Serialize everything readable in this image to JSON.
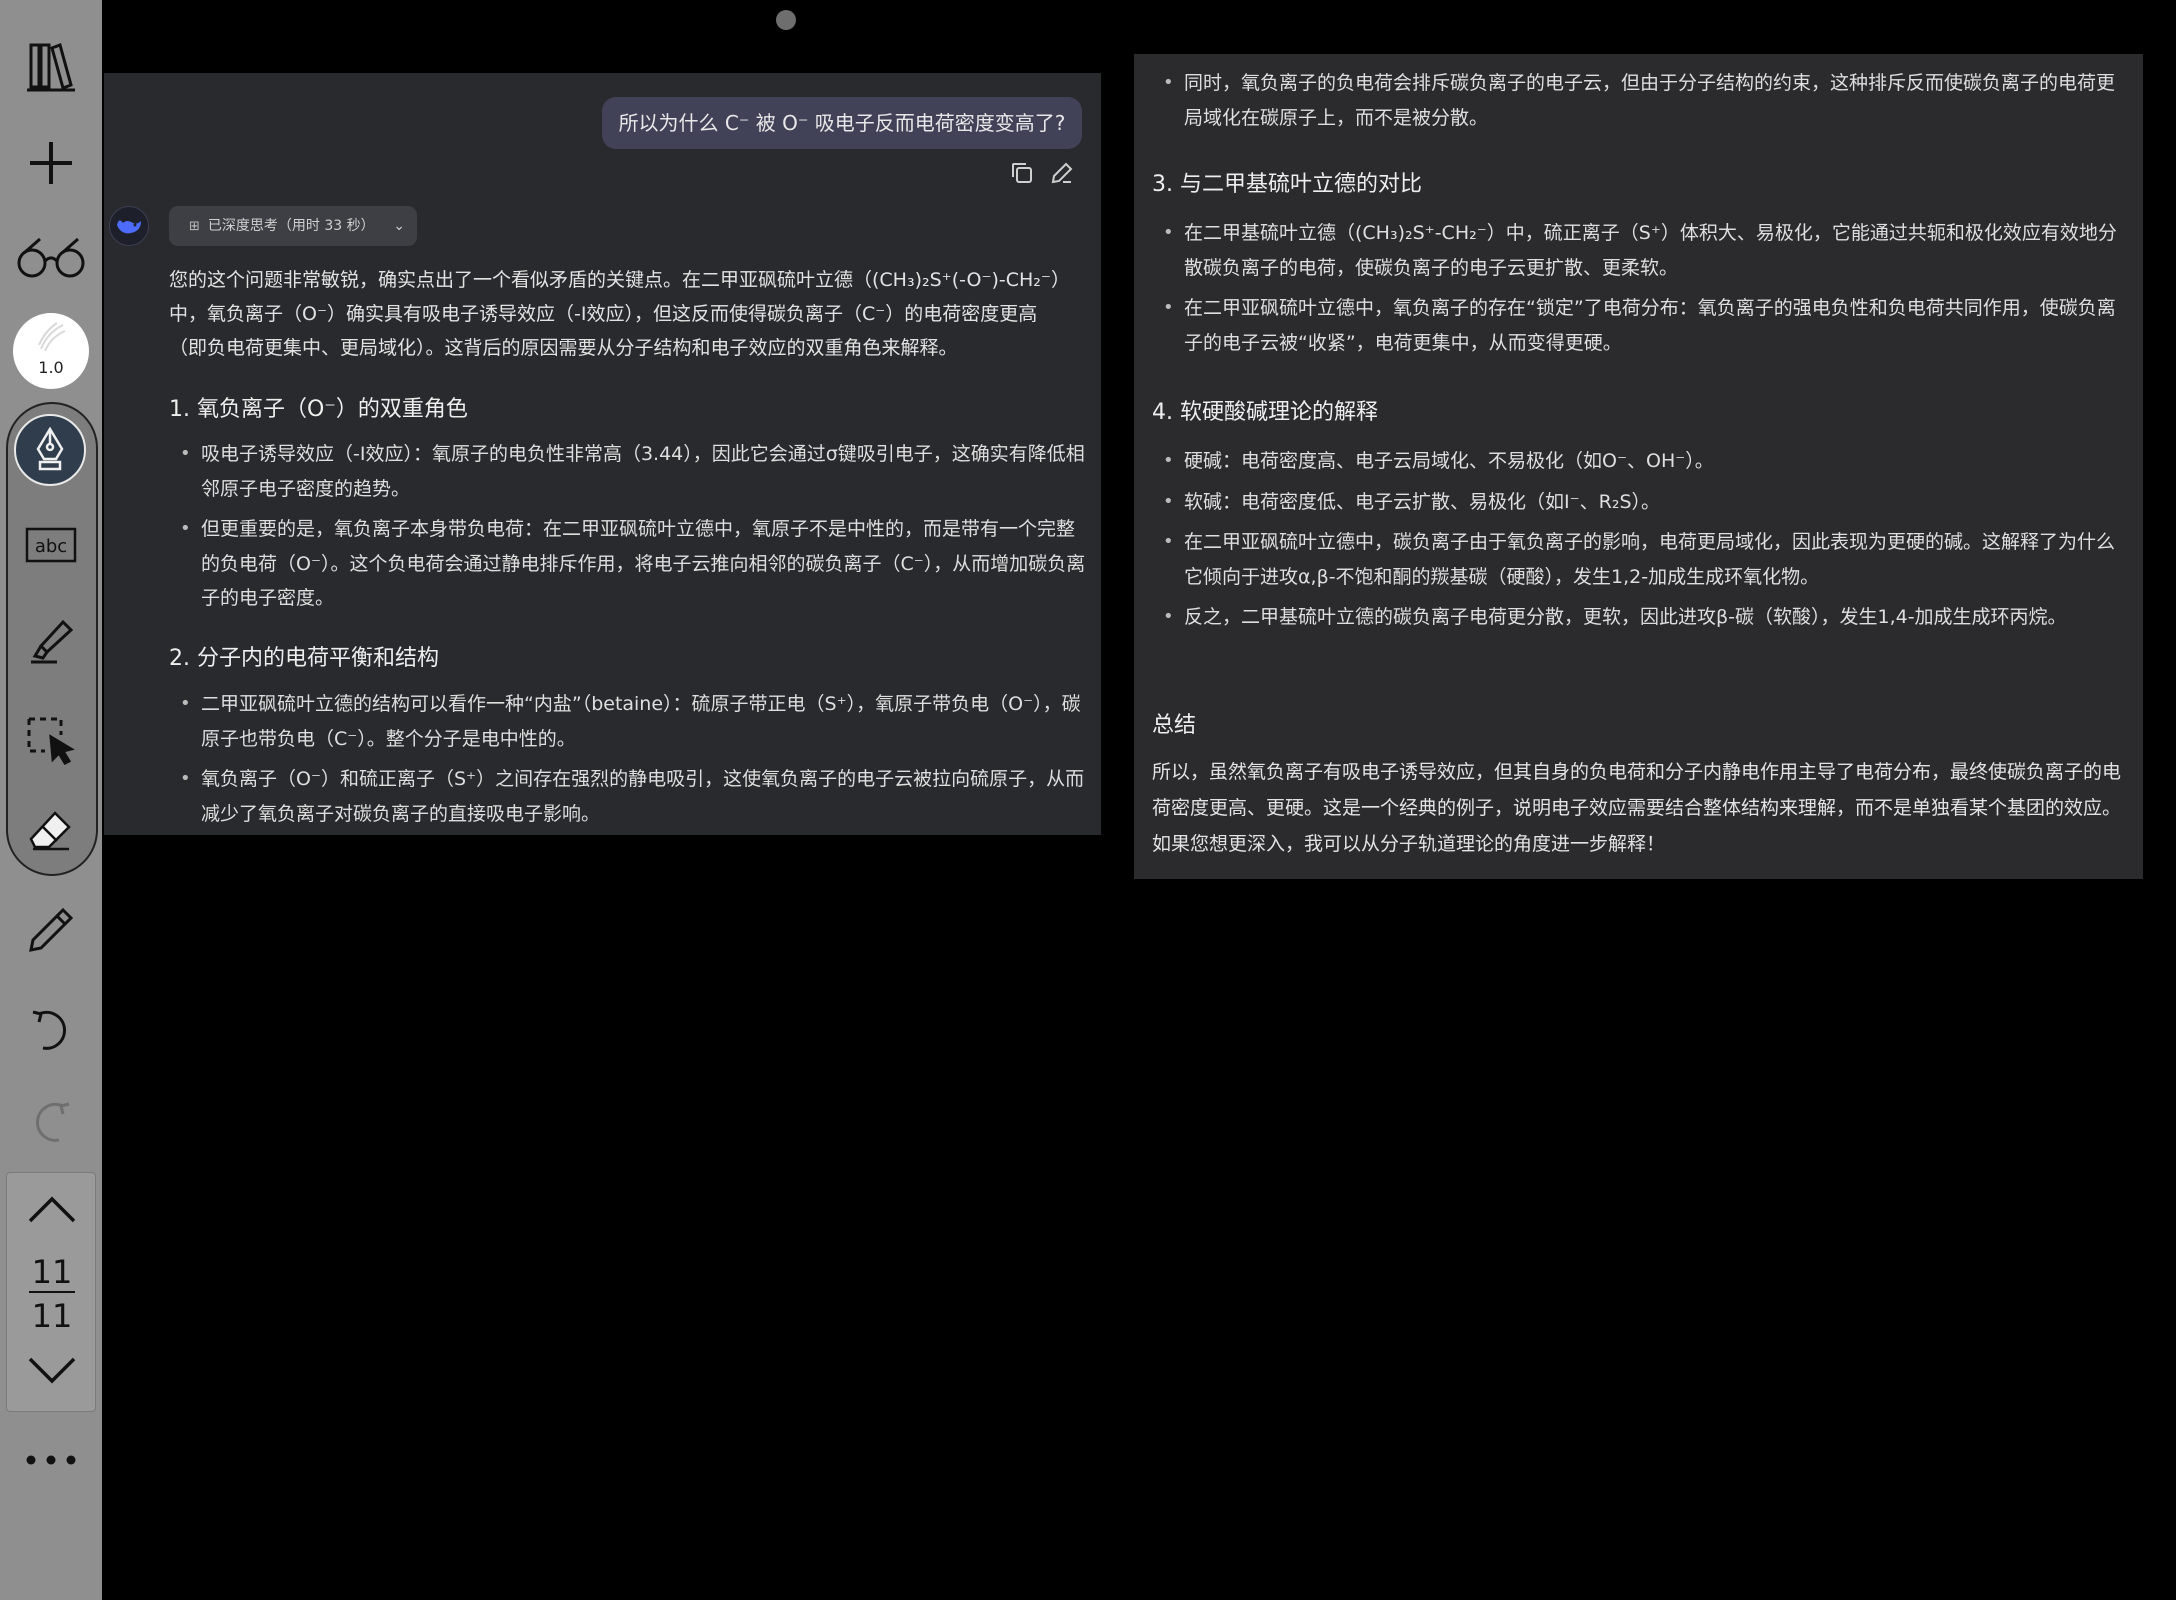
{
  "toolbar": {
    "brush_width": "1.0",
    "page_current": "11",
    "page_total": "11",
    "icons": [
      "library-icon",
      "add-icon",
      "glasses-icon",
      "brush-icon",
      "fountain-pen-icon",
      "text-box-icon",
      "highlighter-icon",
      "lasso-select-icon",
      "eraser-icon",
      "pencil-icon",
      "undo-icon",
      "redo-icon",
      "chevron-up-icon",
      "chevron-down-icon",
      "more-icon"
    ]
  },
  "left_panel": {
    "user_message": "所以为什么 C⁻ 被 O⁻ 吸电子反而电荷密度变高了?",
    "think_label": "已深度思考（用时 33 秒）",
    "intro": "您的这个问题非常敏锐，确实点出了一个看似矛盾的关键点。在二甲亚砜硫叶立德（(CH₃)₂S⁺(-O⁻)-CH₂⁻）中，氧负离子（O⁻）确实具有吸电子诱导效应（-I效应），但这反而使得碳负离子（C⁻）的电荷密度更高（即负电荷更集中、更局域化）。这背后的原因需要从分子结构和电子效应的双重角色来解释。",
    "section1_title": "1. 氧负离子（O⁻）的双重角色",
    "section1_items": [
      "吸电子诱导效应（-I效应）：氧原子的电负性非常高（3.44），因此它会通过σ键吸引电子，这确实有降低相邻原子电子密度的趋势。",
      "但更重要的是，氧负离子本身带负电荷：在二甲亚砜硫叶立德中，氧原子不是中性的，而是带有一个完整的负电荷（O⁻）。这个负电荷会通过静电排斥作用，将电子云推向相邻的碳负离子（C⁻），从而增加碳负离子的电子密度。"
    ],
    "section2_title": "2. 分子内的电荷平衡和结构",
    "section2_items": [
      "二甲亚砜硫叶立德的结构可以看作一种“内盐”（betaine）：硫原子带正电（S⁺），氧原子带负电（O⁻），碳原子也带负电（C⁻）。整个分子是电中性的。",
      "氧负离子（O⁻）和硫正离子（S⁺）之间存在强烈的静电吸引，这使氧负离子的电子云被拉向硫原子，从而减少了氧负离子对碳负离子的直接吸电子影响。"
    ]
  },
  "right_panel": {
    "top_item": "同时，氧负离子的负电荷会排斥碳负离子的电子云，但由于分子结构的约束，这种排斥反而使碳负离子的电荷更局域化在碳原子上，而不是被分散。",
    "section3_title": "3. 与二甲基硫叶立德的对比",
    "section3_items": [
      "在二甲基硫叶立德（(CH₃)₂S⁺-CH₂⁻）中，硫正离子（S⁺）体积大、易极化，它能通过共轭和极化效应有效地分散碳负离子的电荷，使碳负离子的电子云更扩散、更柔软。",
      "在二甲亚砜硫叶立德中，氧负离子的存在“锁定”了电荷分布：氧负离子的强电负性和负电荷共同作用，使碳负离子的电子云被“收紧”，电荷更集中，从而变得更硬。"
    ],
    "section4_title": "4. 软硬酸碱理论的解释",
    "section4_items": [
      "硬碱：电荷密度高、电子云局域化、不易极化（如O⁻、OH⁻）。",
      "软碱：电荷密度低、电子云扩散、易极化（如I⁻、R₂S）。",
      "在二甲亚砜硫叶立德中，碳负离子由于氧负离子的影响，电荷更局域化，因此表现为更硬的碱。这解释了为什么它倾向于进攻α,β-不饱和酮的羰基碳（硬酸），发生1,2-加成生成环氧化物。",
      "反之，二甲基硫叶立德的碳负离子电荷更分散，更软，因此进攻β-碳（软酸），发生1,4-加成生成环丙烷。"
    ],
    "summary_title": "总结",
    "summary_text": "所以，虽然氧负离子有吸电子诱导效应，但其自身的负电荷和分子内静电作用主导了电荷分布，最终使碳负离子的电荷密度更高、更硬。这是一个经典的例子，说明电子效应需要结合整体结构来理解，而不是单独看某个基团的效应。如果您想更深入，我可以从分子轨道理论的角度进一步解释！"
  }
}
